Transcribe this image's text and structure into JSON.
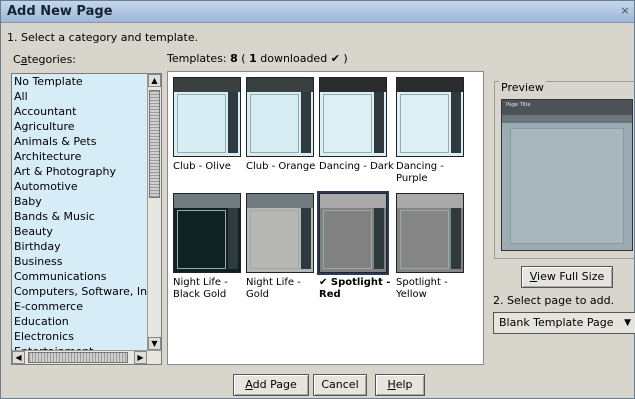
{
  "window": {
    "title": "Add New Page"
  },
  "step1_text": "1. Select a category and template.",
  "categories_label": "Categories:",
  "templates_summary": {
    "prefix": "Templates:",
    "count": "8",
    "open": " ( ",
    "downloaded_count": "1",
    "downloaded_text": " downloaded ",
    "check": "✔",
    "close": " )"
  },
  "categories": [
    "No Template",
    "All",
    "Accountant",
    "Agriculture",
    "Animals & Pets",
    "Architecture",
    "Art & Photography",
    "Automotive",
    "Baby",
    "Bands & Music",
    "Beauty",
    "Birthday",
    "Business",
    "Communications",
    "Computers, Software, Inter",
    "E-commerce",
    "Education",
    "Electronics",
    "Entertainment"
  ],
  "templates": [
    {
      "name": "Club - Olive",
      "body": "#d6eef3",
      "strip": "#39403f"
    },
    {
      "name": "Club - Orange",
      "body": "#d6eef3",
      "strip": "#39403f"
    },
    {
      "name": "Dancing - Dark",
      "body": "#dbeff4",
      "strip": "#2a2c2d"
    },
    {
      "name": "Dancing -\nPurple",
      "body": "#dbeff4",
      "strip": "#2a2c2d"
    },
    {
      "name": "Night Life -\nBlack Gold",
      "body": "#102124",
      "strip": "#6f7b7f"
    },
    {
      "name": "Night Life -\nGold",
      "body": "#b7b8b6",
      "strip": "#6f7b7f"
    },
    {
      "name": "✔ Spotlight -\nRed",
      "body": "#818181",
      "strip": "#a9a9a9",
      "selected": true
    },
    {
      "name": "Spotlight -\nYellow",
      "body": "#858585",
      "strip": "#a9a9a9"
    }
  ],
  "preview": {
    "label": "Preview",
    "page_title": "Page Title"
  },
  "view_full_size": {
    "pre": "",
    "u": "V",
    "post": "iew Full Size"
  },
  "step2_text": "2. Select page to add.",
  "page_select": {
    "value": "Blank Template Page"
  },
  "buttons": {
    "add_page": {
      "u": "A",
      "post": "dd Page"
    },
    "cancel": "Cancel",
    "help": {
      "u": "H",
      "post": "elp"
    }
  },
  "colors": {
    "accent": "#2b3d5e",
    "list_bg": "#d6ecf7"
  }
}
